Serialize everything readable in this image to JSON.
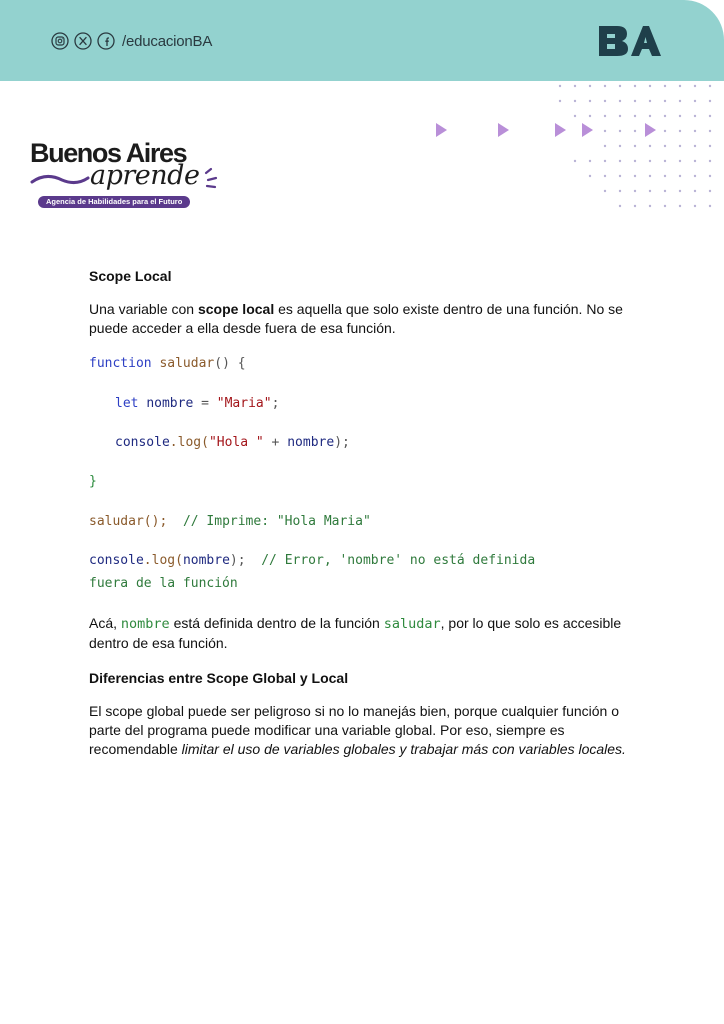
{
  "header": {
    "social_icons": [
      "instagram-icon",
      "x-icon",
      "facebook-icon"
    ],
    "handle": "/educacionBA",
    "logo_text": "BA",
    "band_color": "#93d2cf"
  },
  "brand": {
    "title": "Buenos Aires",
    "script": "aprende",
    "tagline": "Agencia de Habilidades para el Futuro",
    "accent_color": "#5b3a8c"
  },
  "section1": {
    "heading": "Scope Local",
    "intro": {
      "before": "Una variable con ",
      "bold": "scope local",
      "after": " es aquella que solo existe dentro de una función. No se puede acceder a ella desde fuera de esa función."
    }
  },
  "code": {
    "l1_kw": "function",
    "l1_fn": "saludar",
    "l1_rest": "() {",
    "l2_kw": "let",
    "l2_id": "nombre",
    "l2_eq": " = ",
    "l2_str": "\"Maria\"",
    "l2_end": ";",
    "l3_obj": "console",
    "l3_meth": ".log(",
    "l3_str": "\"Hola \"",
    "l3_plus": " + ",
    "l3_id": "nombre",
    "l3_end": ");",
    "l4": "}",
    "l5_call": "saludar();",
    "l5_comment": "// Imprime: \"Hola Maria\"",
    "l6_obj": "console",
    "l6_meth": ".log(",
    "l6_id": "nombre",
    "l6_end": ");",
    "l6_comment": "// Error, 'nombre' no está definida",
    "l7_comment": "fuera de la función"
  },
  "section2": {
    "before": "Acá, ",
    "code1": "nombre",
    "middle": " está definida dentro de la función ",
    "code2": "saludar",
    "after": ", por lo que solo es accesible dentro de esa función."
  },
  "section3": {
    "heading": "Diferencias entre Scope Global y Local",
    "normal": "El scope global puede ser peligroso si no lo manejás bien, porque cualquier función o parte del programa puede modificar una variable global. Por eso, siempre es recomendable ",
    "italic": "limitar el uso de variables globales y trabajar más con variables locales."
  }
}
